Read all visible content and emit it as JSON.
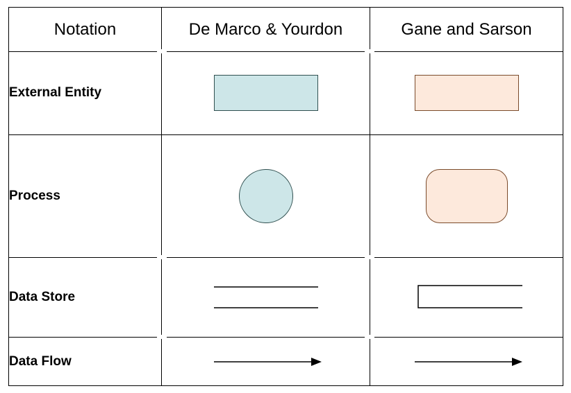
{
  "headers": {
    "notation": "Notation",
    "demarco_yourdon": "De Marco & Yourdon",
    "gane_sarson": "Gane and Sarson"
  },
  "rows": {
    "external_entity": "External Entity",
    "process": "Process",
    "data_store": "Data Store",
    "data_flow": "Data Flow"
  },
  "colors": {
    "yd_fill": "#cde6e8",
    "yd_stroke": "#2f4f4f",
    "gs_fill": "#fde9dc",
    "gs_stroke": "#7a4a2a",
    "line": "#000000"
  },
  "shapes": {
    "external_entity": {
      "yd": "rectangle",
      "gs": "rectangle"
    },
    "process": {
      "yd": "circle",
      "gs": "rounded-rectangle"
    },
    "data_store": {
      "yd": "parallel-lines",
      "gs": "open-rectangle"
    },
    "data_flow": {
      "yd": "arrow",
      "gs": "arrow"
    }
  }
}
